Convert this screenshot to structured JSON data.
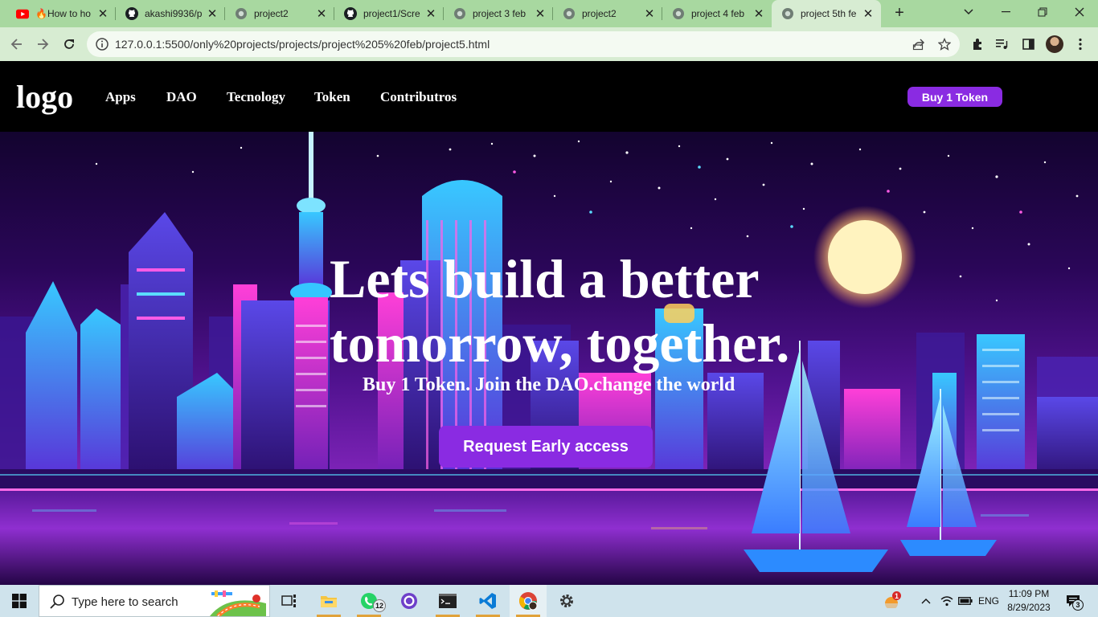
{
  "browser": {
    "tabs": [
      {
        "title": "How to ho",
        "favicon": "youtube-icon",
        "emoji": "🔥"
      },
      {
        "title": "akashi9936/p",
        "favicon": "github-icon"
      },
      {
        "title": "project2",
        "favicon": "globe-icon"
      },
      {
        "title": "project1/Scre",
        "favicon": "github-icon"
      },
      {
        "title": "project 3 feb",
        "favicon": "globe-icon"
      },
      {
        "title": "project2",
        "favicon": "globe-icon"
      },
      {
        "title": "project 4 feb",
        "favicon": "globe-icon"
      },
      {
        "title": "project 5th fe",
        "favicon": "globe-icon",
        "active": true
      }
    ],
    "url": "127.0.0.1:5500/only%20projects/projects/project%205%20feb/project5.html",
    "colors": {
      "tabstrip": "#a8d8a0",
      "toolbar": "#d7ecd2"
    }
  },
  "site": {
    "logo": "logo",
    "nav": [
      "Apps",
      "DAO",
      "Tecnology",
      "Token",
      "Contributros"
    ],
    "buy_button": "Buy 1 Token",
    "hero": {
      "title_line1": "Lets build a better",
      "title_line2": "tomorrow, together.",
      "subtitle": "Buy 1 Token. Join the DAO.change the world",
      "cta": "Request Early access"
    },
    "colors": {
      "accent": "#8a2be2",
      "navbar": "#000000"
    }
  },
  "taskbar": {
    "search_placeholder": "Type here to search",
    "whatsapp_badge": "12",
    "weather_badge": "1",
    "language": "ENG",
    "time": "11:09 PM",
    "date": "8/29/2023",
    "notifications": "3"
  }
}
